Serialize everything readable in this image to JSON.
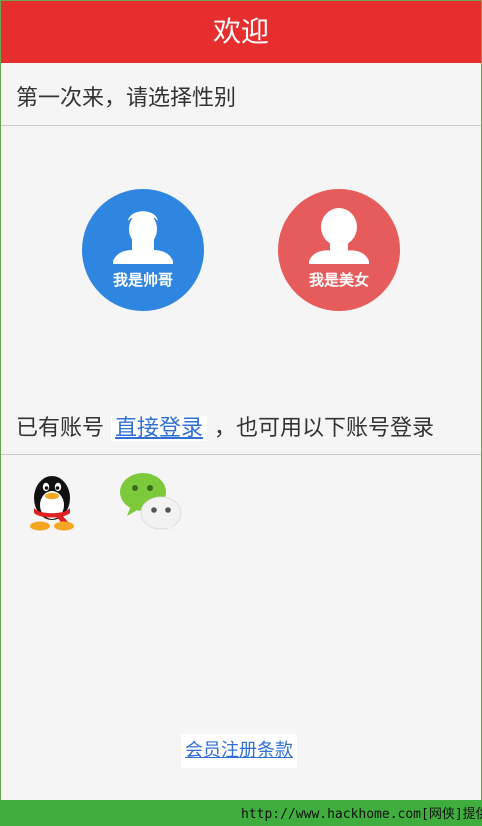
{
  "header": {
    "title": "欢迎"
  },
  "main": {
    "prompt": "第一次来，请选择性别",
    "gender": {
      "male_label": "我是帅哥",
      "female_label": "我是美女"
    },
    "login": {
      "prefix": "已有账号",
      "link_label": "直接登录",
      "suffix": "，也可用以下账号登录"
    },
    "social": [
      {
        "name": "qq-icon"
      },
      {
        "name": "wechat-icon"
      }
    ],
    "terms_label": "会员注册条款"
  },
  "watermark": {
    "text": "http://www.hackhome.com[网侠]提供"
  },
  "colors": {
    "header": "#e62e2e",
    "male": "#2e86e0",
    "female": "#e65b5b",
    "link": "#2f6fd6",
    "footer": "#3fae3f"
  }
}
